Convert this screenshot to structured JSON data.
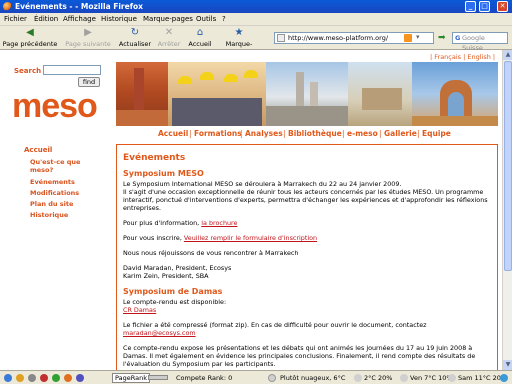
{
  "window": {
    "title": "Evénements - - Mozilla Firefox",
    "min": "_",
    "max": "□",
    "close": "✕"
  },
  "menu": [
    "Fichier",
    "Édition",
    "Affichage",
    "Historique",
    "Marque-pages",
    "Outils",
    "?"
  ],
  "nav": {
    "back": "Page précédente",
    "forward": "Page suivante",
    "reload": "Actualiser",
    "stop": "Arrêter",
    "home": "Accueil",
    "bookmarks": "Marque-pages",
    "url": "http://www.meso-platform.org/",
    "search_placeholder": "Google Suisse"
  },
  "page": {
    "search_label": "Search",
    "find_button": "find",
    "logo": "meso",
    "languages": "| Français | English |",
    "topnav": [
      "Accueil",
      "Formations",
      "Analyses",
      "Bibliothèque",
      "e-meso",
      "Gallerie",
      "Equipe"
    ],
    "sidebar": {
      "head": "Accueil",
      "items": [
        "Qu'est-ce que meso?",
        "Evénements",
        "Modifications",
        "Plan du site",
        "Historique"
      ]
    },
    "content": {
      "title": "Evénements",
      "s1_title": "Symposium MESO",
      "s1_p1": "Le Symposium International MESO se déroulera à Marrakech du 22 au 24 janvier 2009.",
      "s1_p2": "Il s'agit d'une occasion exceptionnelle de réunir tous les acteurs concernés par les études MESO. Un programme interactif, ponctué d'interventions d'experts, permettra d'échanger les expériences et d'approfondir les réflexions entreprises.",
      "s1_info_prefix": "Pour plus d'information, ",
      "s1_info_link": "la brochure",
      "s1_reg_prefix": "Pour vous inscrire, ",
      "s1_reg_link": "Veuillez remplir le formulaire d'inscription",
      "s1_p3": "Nous nous réjouissons de vous rencontrer à Marrakech",
      "s1_sig1": "David Maradan, President, Ecosys",
      "s1_sig2": "Karim Zein, President, SBA",
      "s2_title": "Symposium de Damas",
      "s2_p1": "Le compte-rendu est disponible:",
      "s2_link": "CR Damas",
      "s2_p2_prefix": "Le fichier a été compressé (format zip). En cas de difficulté pour ouvrir le document, contactez ",
      "s2_email": "maradan@ecosys.com",
      "s2_p3": "Ce compte-rendu expose les présentations et les débats qui ont animés les journées du 17 au 19 juin 2008 à Damas. Il met également en évidence les principales conclusions. Finalement, il rend compte des résultats de l'évaluation du Symposium par les participants."
    }
  },
  "status": {
    "pagerank": "PageRank",
    "compete": "Compete Rank: 0",
    "weather1": "Plutôt nuageux, 6°C",
    "w2": "2°C 20%",
    "w3": "Ven 7°C 10%",
    "w4": "Sam 11°C 20%"
  }
}
